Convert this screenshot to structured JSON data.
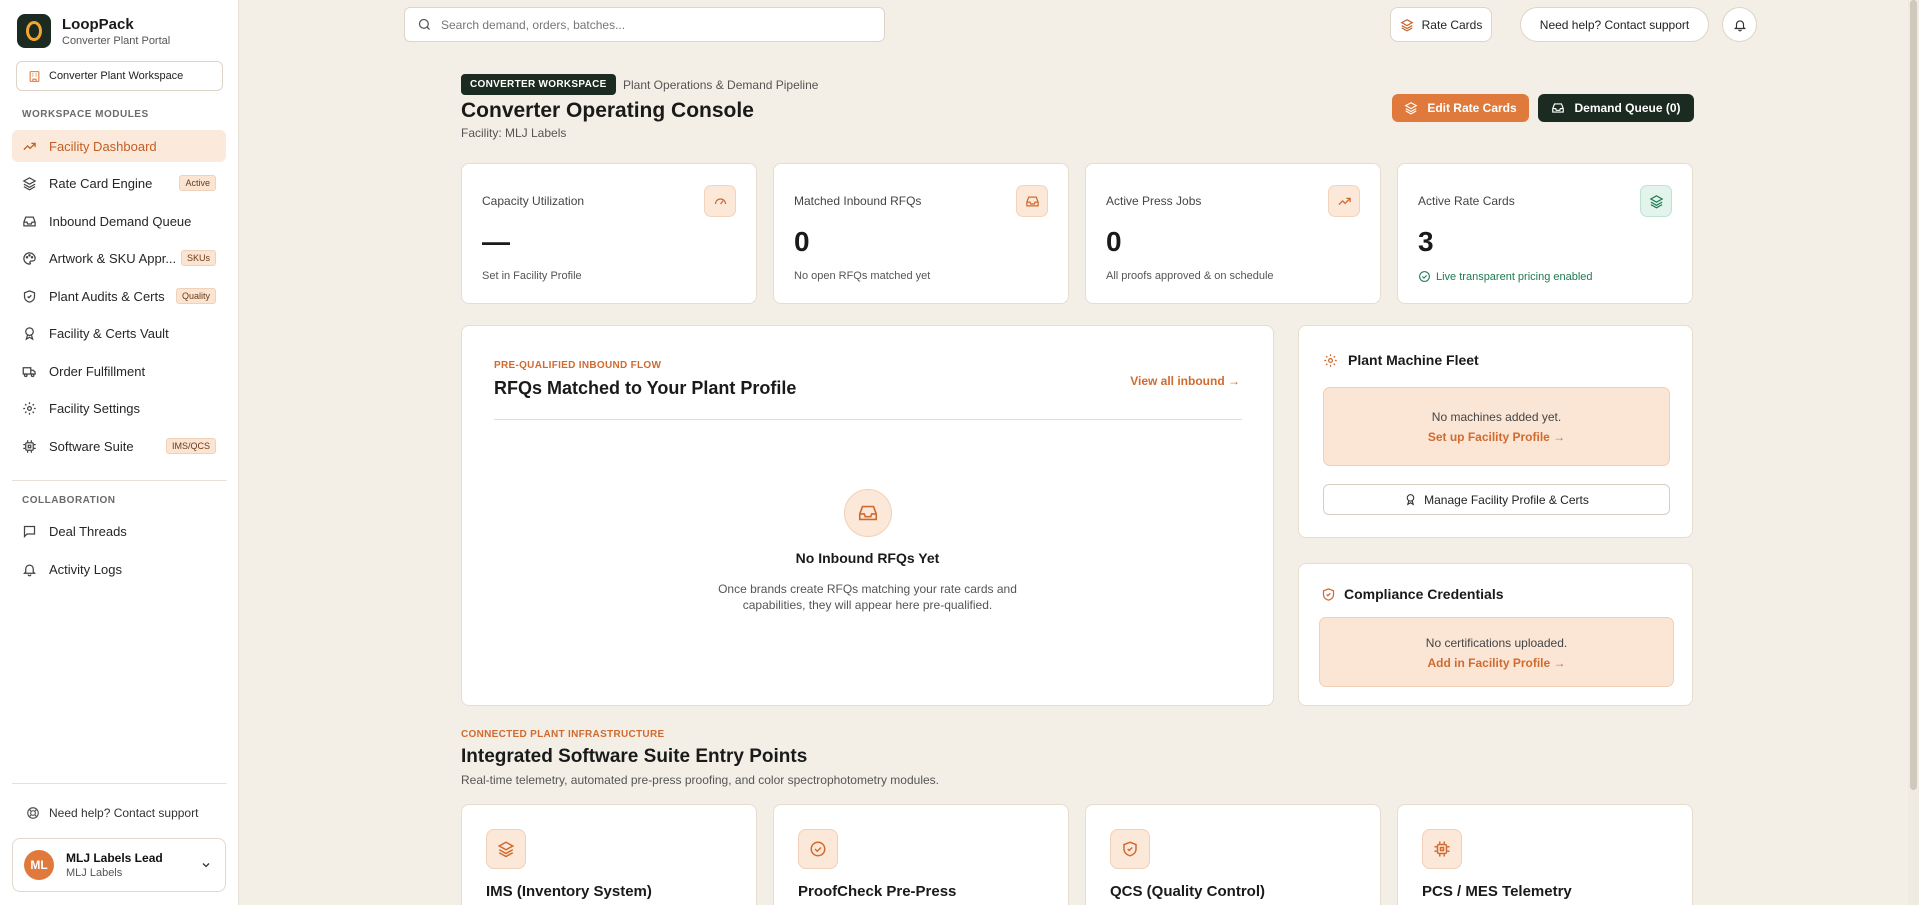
{
  "brand": {
    "name": "LoopPack",
    "subtitle": "Converter Plant Portal"
  },
  "workspace_select": "Converter Plant Workspace",
  "sidebar": {
    "modules_heading": "WORKSPACE MODULES",
    "items": [
      {
        "label": "Facility Dashboard",
        "icon": "trending-up-icon",
        "active": true
      },
      {
        "label": "Rate Card Engine",
        "icon": "layers-icon",
        "badge": "Active"
      },
      {
        "label": "Inbound Demand Queue",
        "icon": "inbox-icon"
      },
      {
        "label": "Artwork & SKU Appr...",
        "icon": "palette-icon",
        "badge": "SKUs"
      },
      {
        "label": "Plant Audits & Certs",
        "icon": "shield-check-icon",
        "badge": "Quality"
      },
      {
        "label": "Facility & Certs Vault",
        "icon": "award-icon"
      },
      {
        "label": "Order Fulfillment",
        "icon": "truck-icon"
      },
      {
        "label": "Facility Settings",
        "icon": "gear-icon"
      },
      {
        "label": "Software Suite",
        "icon": "cpu-icon",
        "badge": "IMS/QCS"
      }
    ],
    "collab_heading": "COLLABORATION",
    "collab_items": [
      {
        "label": "Deal Threads",
        "icon": "message-icon"
      },
      {
        "label": "Activity Logs",
        "icon": "bell-icon"
      }
    ],
    "help": "Need help? Contact support",
    "user": {
      "initials": "ML",
      "name": "MLJ Labels Lead",
      "org": "MLJ Labels"
    }
  },
  "topbar": {
    "search_placeholder": "Search demand, orders, batches...",
    "rate_cards": "Rate Cards",
    "help": "Need help? Contact support"
  },
  "header": {
    "chip": "CONVERTER WORKSPACE",
    "path": "Plant Operations & Demand Pipeline",
    "title": "Converter Operating Console",
    "facility": "Facility: MLJ Labels",
    "edit_rate_cards": "Edit Rate Cards",
    "demand_queue": "Demand Queue (0)"
  },
  "stats": [
    {
      "label": "Capacity Utilization",
      "value": "—",
      "note": "Set in Facility Profile",
      "icon": "gauge-icon"
    },
    {
      "label": "Matched Inbound RFQs",
      "value": "0",
      "note": "No open RFQs matched yet",
      "icon": "inbox-icon"
    },
    {
      "label": "Active Press Jobs",
      "value": "0",
      "note": "All proofs approved & on schedule",
      "icon": "trending-up-icon"
    },
    {
      "label": "Active Rate Cards",
      "value": "3",
      "note": "Live transparent pricing enabled",
      "icon": "layers-icon"
    }
  ],
  "rfq": {
    "eyebrow": "PRE-QUALIFIED INBOUND FLOW",
    "title": "RFQs Matched to Your Plant Profile",
    "view_all": "View all inbound →",
    "empty_title": "No Inbound RFQs Yet",
    "empty_line1": "Once brands create RFQs matching your rate cards and",
    "empty_line2": "capabilities, they will appear here pre-qualified."
  },
  "fleet": {
    "title": "Plant Machine Fleet",
    "empty": "No machines added yet.",
    "link": "Set up Facility Profile →",
    "manage": "Manage Facility Profile & Certs"
  },
  "compliance": {
    "title": "Compliance Credentials",
    "empty": "No certifications uploaded.",
    "link": "Add in Facility Profile →"
  },
  "software": {
    "eyebrow": "CONNECTED PLANT INFRASTRUCTURE",
    "title": "Integrated Software Suite Entry Points",
    "subtitle": "Real-time telemetry, automated pre-press proofing, and color spectrophotometry modules.",
    "cards": [
      {
        "title": "IMS (Inventory System)",
        "icon": "layers-icon"
      },
      {
        "title": "ProofCheck Pre-Press",
        "icon": "check-circle-icon"
      },
      {
        "title": "QCS (Quality Control)",
        "icon": "shield-check-icon"
      },
      {
        "title": "PCS / MES Telemetry",
        "icon": "cpu-icon"
      }
    ]
  },
  "colors": {
    "accent": "#e07a3c",
    "dark": "#1c2b22",
    "background": "#f4efe6",
    "success": "#1f7a52"
  }
}
